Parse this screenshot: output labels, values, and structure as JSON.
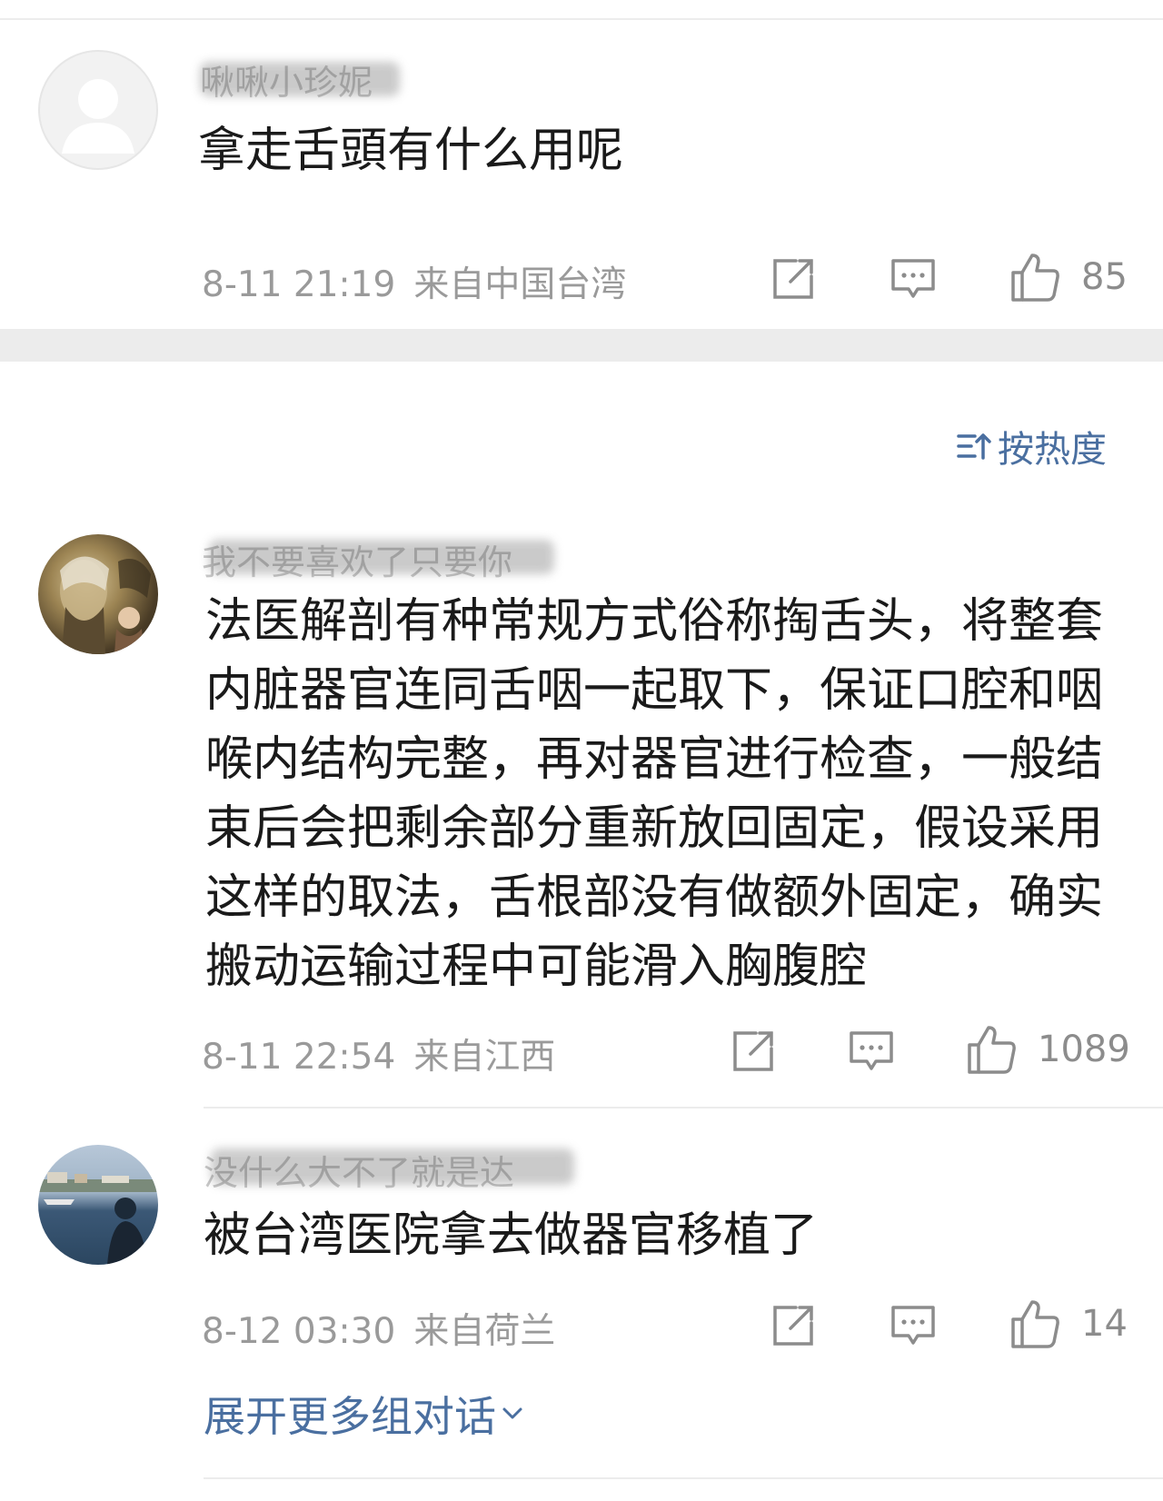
{
  "comments": [
    {
      "username": "啾啾小珍妮",
      "text": "拿走舌頭有什么用呢",
      "time": "8-11 21:19",
      "location": "来自中国台湾",
      "likes": "85"
    },
    {
      "username": "我不要喜欢了只要你",
      "text": "法医解剖有种常规方式俗称掏舌头，将整套内脏器官连同舌咽一起取下，保证口腔和咽喉内结构完整，再对器官进行检查，一般结束后会把剩余部分重新放回固定，假设采用这样的取法，舌根部没有做额外固定，确实搬动运输过程中可能滑入胸腹腔",
      "time": "8-11 22:54",
      "location": "来自江西",
      "likes": "1089"
    },
    {
      "username": "没什么大不了就是达",
      "text": "被台湾医院拿去做器官移植了",
      "time": "8-12 03:30",
      "location": "来自荷兰",
      "likes": "14"
    }
  ],
  "sort": {
    "label": "按热度"
  },
  "expand_more": {
    "label": "展开更多组对话"
  },
  "colors": {
    "accent_blue": "#4a6fa0",
    "meta_gray": "#9a9a9a",
    "separator": "#ececec"
  },
  "icons": [
    "share-icon",
    "comment-icon",
    "like-icon",
    "sort-icon",
    "chevron-down-icon"
  ]
}
